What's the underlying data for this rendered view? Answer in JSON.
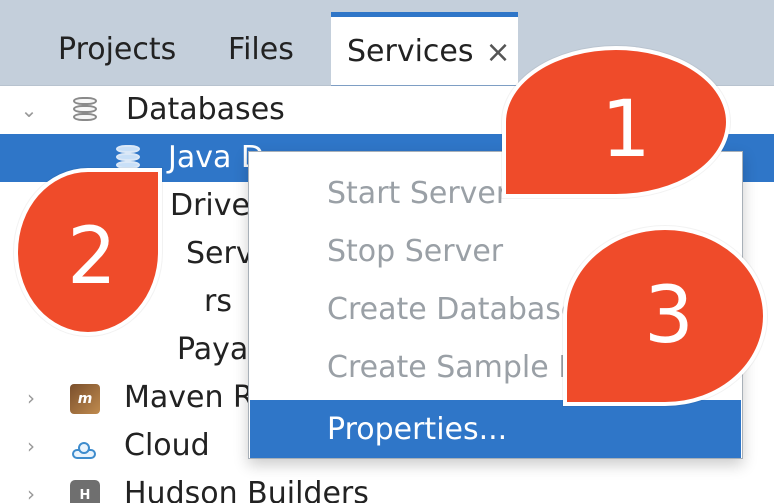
{
  "tabs": {
    "projects": "Projects",
    "files": "Files",
    "services": "Services",
    "close_glyph": "×"
  },
  "tree": {
    "databases": "Databases",
    "java_db": "Java D",
    "drivers": "Drive",
    "servers": "Serv",
    "partial_4": "rs",
    "payara": "Payar",
    "maven": "Maven R",
    "cloud": "Cloud",
    "hudson": "Hudson Builders"
  },
  "context_menu": {
    "start_server": "Start Server",
    "stop_server": "Stop Server",
    "create_database": "Create Database...",
    "create_sample": "Create Sample Da",
    "properties": "Properties..."
  },
  "callouts": {
    "one": "1",
    "two": "2",
    "three": "3"
  },
  "colors": {
    "selection": "#2f76c8",
    "callout": "#ef4b2a",
    "tab_bar": "#c4cfdb"
  },
  "icons": {
    "close": "close-icon",
    "database": "database-icon",
    "maven": "maven-icon",
    "cloud": "cloud-icon",
    "hudson": "hudson-icon",
    "chevron_down": "chevron-down-icon",
    "chevron_right": "chevron-right-icon"
  }
}
